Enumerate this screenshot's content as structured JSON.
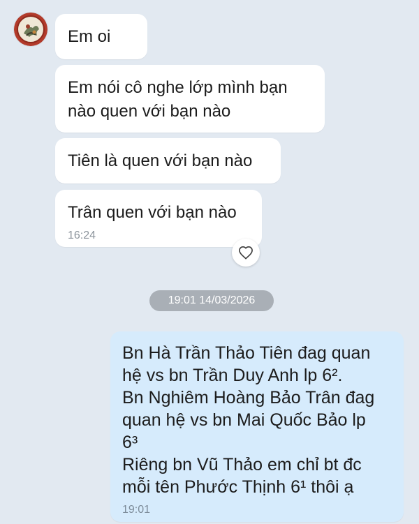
{
  "colors": {
    "background": "#e2e9f1",
    "incoming_bubble": "#ffffff",
    "outgoing_bubble": "#d6ebfc",
    "date_pill": "#a9afb6"
  },
  "contact": {
    "avatar_icon": "avatar"
  },
  "incoming_messages": [
    {
      "text": "Em oi"
    },
    {
      "lines": [
        "Em nói cô nghe lớp mình bạn",
        "nào quen với bạn nào"
      ]
    },
    {
      "text": "Tiên là quen với bạn nào"
    },
    {
      "text": "Trân quen với bạn nào",
      "time": "16:24"
    }
  ],
  "reaction": {
    "icon": "heart-icon"
  },
  "date_separator": "19:01 14/03/2026",
  "outgoing_message": {
    "lines": [
      "Bn Hà Trần Thảo Tiên đag quan",
      "hệ vs bn Trần Duy Anh lp 6².",
      "Bn Nghiêm Hoàng Bảo Trân đag",
      "quan hệ vs bn Mai Quốc Bảo lp",
      "6³",
      "Riêng bn Vũ Thảo em chỉ bt đc",
      "mỗi tên Phước Thịnh 6¹ thôi ạ"
    ],
    "time": "19:01"
  }
}
